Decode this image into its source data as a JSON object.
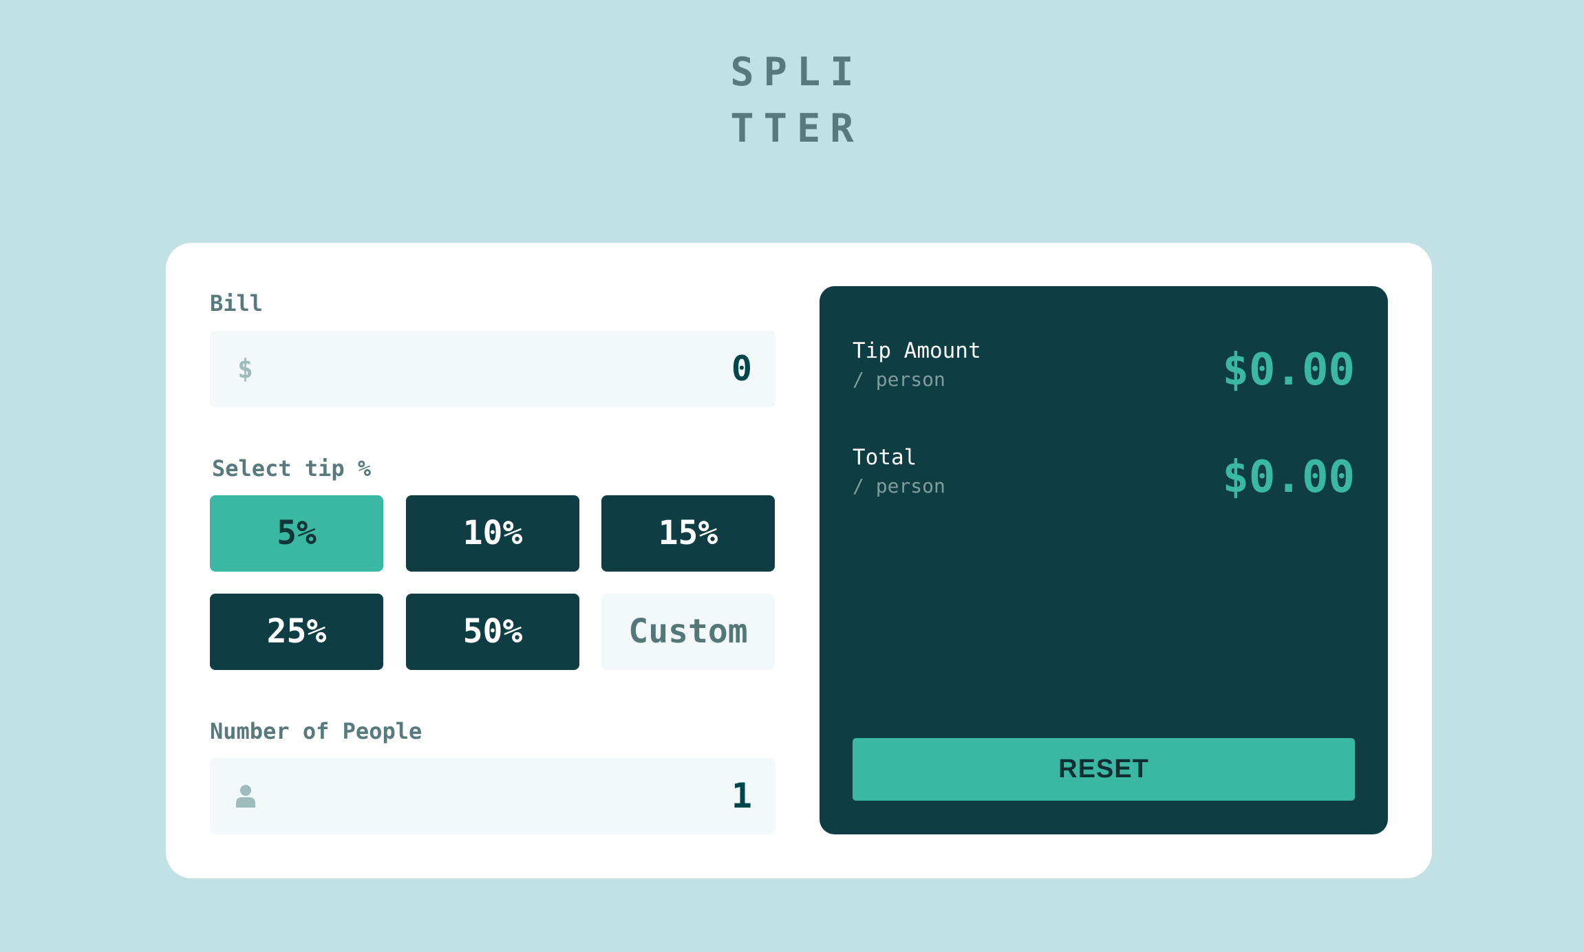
{
  "app": {
    "logo_line1": "SPLI",
    "logo_line2": "TTER"
  },
  "bill": {
    "label": "Bill",
    "icon": "dollar-icon",
    "icon_glyph": "$",
    "value": "0"
  },
  "tip": {
    "label": "Select tip %",
    "options": [
      {
        "label": "5%",
        "selected": true
      },
      {
        "label": "10%",
        "selected": false
      },
      {
        "label": "15%",
        "selected": false
      },
      {
        "label": "25%",
        "selected": false
      },
      {
        "label": "50%",
        "selected": false
      }
    ],
    "custom_placeholder": "Custom"
  },
  "people": {
    "label": "Number of People",
    "icon": "person-icon",
    "value": "1"
  },
  "results": {
    "tip_amount_label": "Tip Amount",
    "tip_amount_sub": "/ person",
    "tip_amount_value": "$0.00",
    "total_label": "Total",
    "total_sub": "/ person",
    "total_value": "$0.00",
    "reset_label": "RESET"
  },
  "colors": {
    "background": "#c2e1e4",
    "card": "#ffffff",
    "dark_panel": "#0f3d44",
    "accent": "#3ab8a4",
    "label_text": "#587a7c",
    "input_bg": "#f3f9fa"
  }
}
